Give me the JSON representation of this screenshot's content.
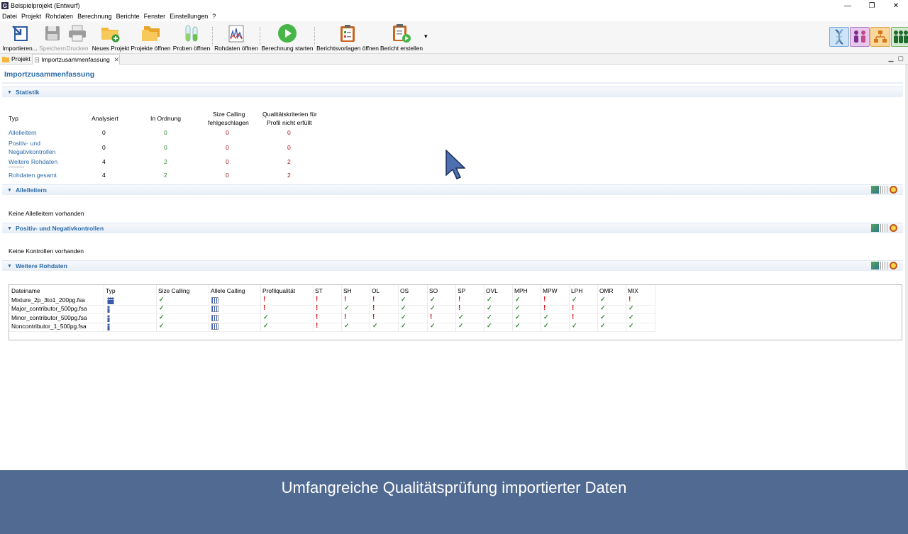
{
  "window": {
    "title": "Beispielprojekt (Entwurf)",
    "app_letter": "G",
    "minimize": "—",
    "restore": "❐",
    "close": "✕"
  },
  "menu": [
    "Datei",
    "Projekt",
    "Rohdaten",
    "Berechnung",
    "Berichte",
    "Fenster",
    "Einstellungen",
    "?"
  ],
  "toolbar": {
    "import": "Importieren...",
    "save": "Speichern",
    "print": "Drucken",
    "new_project": "Neues Projekt",
    "open_projects": "Projekte öffnen",
    "open_samples": "Proben öffnen",
    "open_rawdata": "Rohdaten öffnen",
    "start_calc": "Berechnung starten",
    "open_templates": "Berichtsvorlagen öffnen",
    "create_report": "Bericht erstellen",
    "dropdown": "▾"
  },
  "tabs": {
    "project": "Projekt",
    "summary": "Importzusammenfassung",
    "close": "✕"
  },
  "page_title": "Importzusammenfassung",
  "sections": {
    "statistik": "Statistik",
    "allelleitern": "Allelleitern",
    "kontrollen": "Positiv- und Negativkontrollen",
    "weitere": "Weitere Rohdaten"
  },
  "stats": {
    "headers": {
      "typ": "Typ",
      "analysiert": "Analysiert",
      "in_ordnung": "In Ordnung",
      "size_calling_1": "Size Calling",
      "size_calling_2": "fehlgeschlagen",
      "quali_1": "Qualitätskriterien für",
      "quali_2": "Profil nicht erfüllt"
    },
    "rows": [
      {
        "typ": "Allelleitern",
        "analysiert": "0",
        "ok": "0",
        "sc": "0",
        "q": "0"
      },
      {
        "typ": "Positiv- und",
        "typ2": "Negativkontrollen",
        "analysiert": "0",
        "ok": "0",
        "sc": "0",
        "q": "0"
      },
      {
        "typ": "Weitere Rohdaten",
        "analysiert": "4",
        "ok": "2",
        "sc": "0",
        "q": "2"
      },
      {
        "typ": "Rohdaten gesamt",
        "analysiert": "4",
        "ok": "2",
        "sc": "0",
        "q": "2"
      }
    ]
  },
  "empty": {
    "allelleitern": "Keine Allelleitern vorhanden",
    "kontrollen": "Keine Kontrollen vorhanden"
  },
  "grid": {
    "columns": [
      "Dateiname",
      "Typ",
      "Size Calling",
      "Allele Calling",
      "Profilqualität",
      "ST",
      "SH",
      "OL",
      "OS",
      "SO",
      "SP",
      "OVL",
      "MPH",
      "MPW",
      "LPH",
      "OMR",
      "MIX"
    ],
    "rows": [
      {
        "file": "Mixture_2p_3to1_200pg.fsa",
        "typ": "mixture",
        "status": [
          "ok",
          "chart",
          "warn",
          "warn",
          "warn",
          "warn",
          "ok",
          "ok",
          "warn",
          "ok",
          "ok",
          "warn",
          "ok",
          "ok",
          "warn"
        ]
      },
      {
        "file": "Major_contributor_500pg.fsa",
        "typ": "single",
        "status": [
          "ok",
          "chart",
          "warn",
          "warn",
          "ok",
          "warn",
          "ok",
          "ok",
          "warn",
          "ok",
          "ok",
          "warn",
          "warn",
          "ok",
          "ok"
        ]
      },
      {
        "file": "Minor_contributor_500pg.fsa",
        "typ": "single",
        "status": [
          "ok",
          "chart",
          "ok",
          "warn",
          "warn",
          "warn",
          "ok",
          "warn",
          "ok",
          "ok",
          "ok",
          "ok",
          "warn",
          "ok",
          "ok"
        ]
      },
      {
        "file": "Noncontributor_1_500pg.fsa",
        "typ": "single",
        "status": [
          "ok",
          "chart",
          "ok",
          "warn",
          "ok",
          "ok",
          "ok",
          "ok",
          "ok",
          "ok",
          "ok",
          "ok",
          "ok",
          "ok",
          "ok"
        ]
      }
    ]
  },
  "symbols": {
    "ok": "✓",
    "warn": "!"
  },
  "banner": "Umfangreiche Qualitätsprüfung importierter Daten",
  "colors": {
    "accent": "#2b6aa8",
    "banner": "#506a92",
    "ok": "#2e8b2e",
    "warn": "#d21414"
  }
}
